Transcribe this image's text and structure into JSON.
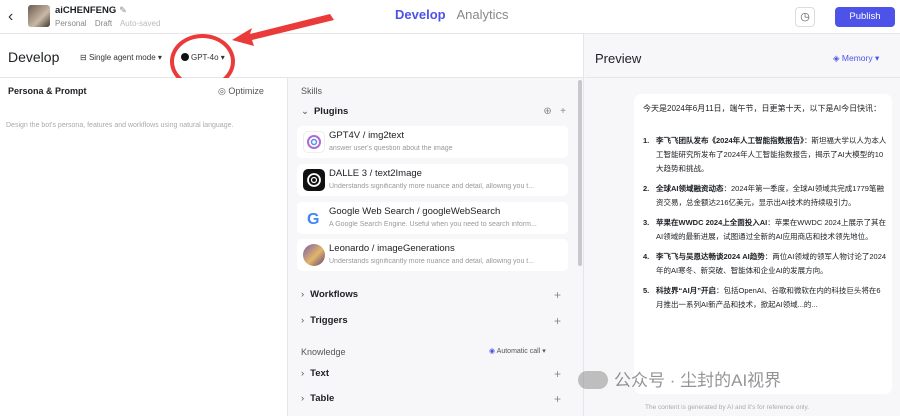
{
  "header": {
    "bot_name": "aiCHENFENG",
    "edit_glyph": "✎",
    "scope": "Personal",
    "status": "Draft",
    "autosave": "Auto-saved",
    "tabs": [
      {
        "label": "Develop",
        "active": true
      },
      {
        "label": "Analytics",
        "active": false
      }
    ],
    "publish_label": "Publish",
    "history_icon": "history-icon",
    "accent_color": "#4d53e8"
  },
  "develop": {
    "title": "Develop",
    "agent_mode": "Single agent mode ▾",
    "model": "GPT-4o ▾",
    "persona_title": "Persona & Prompt",
    "optimize_label": "Optimize",
    "persona_placeholder": "Design the bot's persona, features and workflows using natural language."
  },
  "skills": {
    "title": "Skills",
    "plugins_label": "Plugins",
    "plugins": [
      {
        "name": "GPT4V / img2text",
        "desc": "answer user's question about the image",
        "icon": "openai-icon"
      },
      {
        "name": "DALLE 3 / text2Image",
        "desc": "Understands significantly more nuance and detail, allowing you t...",
        "icon": "openai-dark-icon"
      },
      {
        "name": "Google Web Search / googleWebSearch",
        "desc": "A Google Search Engine. Useful when you need to search inform...",
        "icon": "google-icon"
      },
      {
        "name": "Leonardo / imageGenerations",
        "desc": "Understands significantly more nuance and detail, allowing you t...",
        "icon": "leonardo-icon"
      }
    ],
    "workflows_label": "Workflows",
    "triggers_label": "Triggers",
    "knowledge_label": "Knowledge",
    "auto_call": "Automatic call ▾",
    "text_label": "Text",
    "table_label": "Table"
  },
  "preview": {
    "title": "Preview",
    "memory_label": "Memory ▾",
    "intro": "今天是2024年6月11日，端午节，日更第十天，以下是AI今日快讯：",
    "news": [
      {
        "num": "1.",
        "title": "李飞飞团队发布《2024年人工智能指数报告》",
        "body": "：斯坦福大学以人为本人工智能研究所发布了2024年人工智能指数报告，揭示了AI大模型的10大趋势和挑战。"
      },
      {
        "num": "2.",
        "title": "全球AI领域融资动态",
        "body": "：2024年第一季度，全球AI领域共完成1779笔融资交易，总金额达216亿美元，显示出AI技术的持续吸引力。"
      },
      {
        "num": "3.",
        "title": "苹果在WWDC 2024上全面投入AI",
        "body": "：苹果在WWDC 2024上展示了其在AI领域的最新进展，试图通过全新的AI应用商店和技术领先地位。"
      },
      {
        "num": "4.",
        "title": "李飞飞与吴恩达畅谈2024 AI趋势",
        "body": "：两位AI领域的领军人物讨论了2024年的AI寒冬、新突破、智能体和企业AI的发展方向。"
      },
      {
        "num": "5.",
        "title": "科技界“AI月”开启",
        "body": "：包括OpenAI、谷歌和微软在内的科技巨头将在6月推出一系列AI新产品和技术，掀起AI领域...的..."
      }
    ],
    "disclaimer": "The content is generated by AI and it's for reference only."
  },
  "watermark": "公众号 · 尘封的AI视界"
}
